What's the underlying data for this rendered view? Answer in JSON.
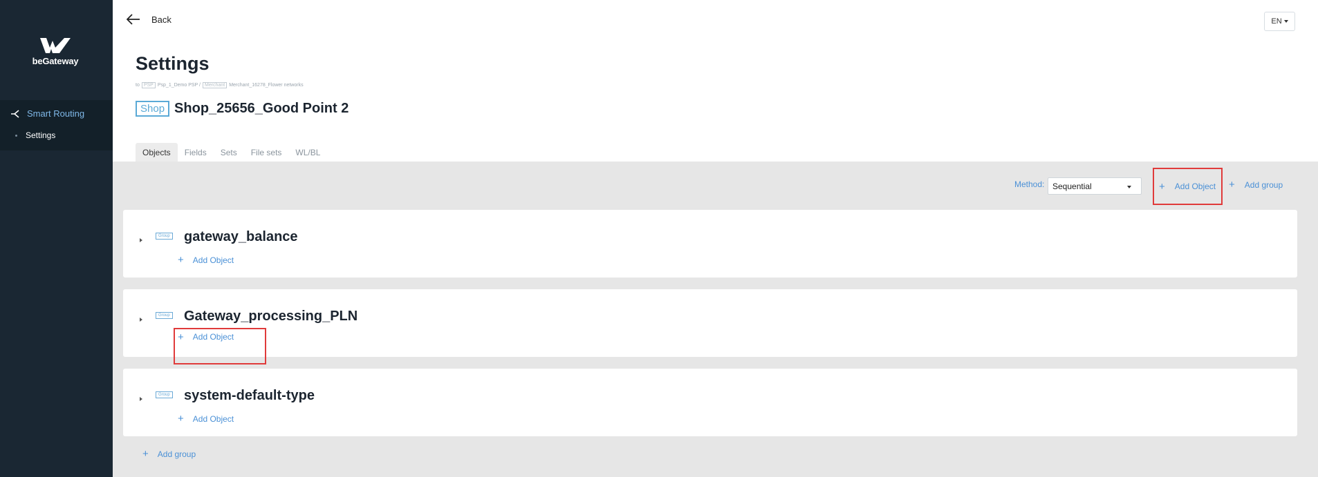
{
  "brand": {
    "name": "beGateway"
  },
  "sidebar": {
    "section_label": "Smart Routing",
    "sub_item_label": "Settings"
  },
  "header": {
    "back_label": "Back",
    "language": "EN",
    "page_title": "Settings",
    "breadcrumb": {
      "prefix": "to",
      "psp_tag": "PSP",
      "psp_name": "Psp_1_Demo PSP /",
      "merchant_tag": "Merchant",
      "merchant_name": "Merchant_16278_Flower networks"
    },
    "shop_tag": "Shop",
    "shop_name": "Shop_25656_Good Point 2"
  },
  "tabs": [
    {
      "label": "Objects",
      "active": true
    },
    {
      "label": "Fields",
      "active": false
    },
    {
      "label": "Sets",
      "active": false
    },
    {
      "label": "File sets",
      "active": false
    },
    {
      "label": "WL/BL",
      "active": false
    }
  ],
  "toolbar": {
    "method_label": "Method:",
    "method_value": "Sequential",
    "add_object_label": "Add Object",
    "add_group_label": "Add group"
  },
  "groups": [
    {
      "tag": "Group",
      "name": "gateway_balance",
      "add_object_label": "Add Object"
    },
    {
      "tag": "Group",
      "name": "Gateway_processing_PLN",
      "add_object_label": "Add Object"
    },
    {
      "tag": "Group",
      "name": "system-default-type",
      "add_object_label": "Add Object"
    }
  ],
  "footer": {
    "add_group_label": "Add group"
  },
  "colors": {
    "sidebar_bg": "#1a2733",
    "accent": "#4a90d6",
    "highlight": "#e03a3a",
    "content_bg": "#e6e6e6"
  }
}
